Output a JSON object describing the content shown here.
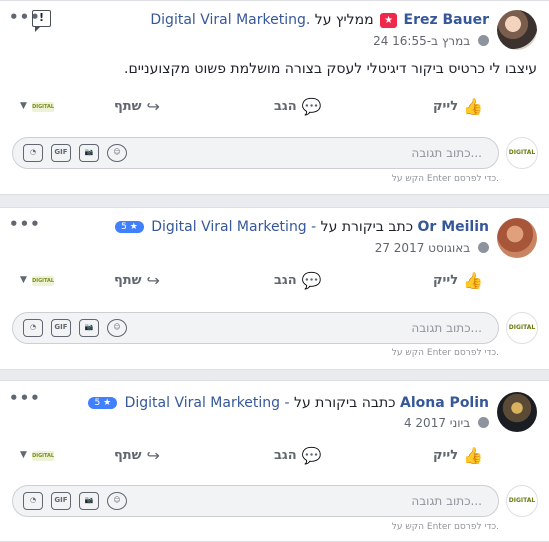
{
  "common": {
    "more": "•••",
    "like": "לייק",
    "comment": "הגב",
    "share": "שתף",
    "comment_placeholder": "כתוב תגובה...",
    "post_hint": "הקש על Enter כדי לפרסם.",
    "page_avatar_text": "DIGITAL",
    "gif": "GIF",
    "page_mini": "DIGITAL"
  },
  "posts": [
    {
      "author": "Erez Bauer",
      "verb": "ממליץ על",
      "page": "Digital Viral Marketing.",
      "time": "24 במרץ ב-16:55",
      "text": "עיצבו לי כרטיס ביקור דיגיטלי לעסק בצורה מושלמת פשוט מקצועניים."
    },
    {
      "author": "Or Meilin",
      "verb": "כתב ביקורת על",
      "page": "Digital Viral Marketing -",
      "rating": "5 ★",
      "time": "27 באוגוסט 2017"
    },
    {
      "author": "Alona Polin",
      "verb": "כתבה ביקורת על",
      "page": "Digital Viral Marketing -",
      "rating": "5 ★",
      "time": "4 ביוני 2017"
    }
  ],
  "icons": {
    "report": "!",
    "like": "👍",
    "comment": "💬",
    "share": "↪",
    "dropdown": "▼",
    "recommend": "★",
    "camera": "📷",
    "emoji": "☺",
    "sticker": "◔"
  }
}
